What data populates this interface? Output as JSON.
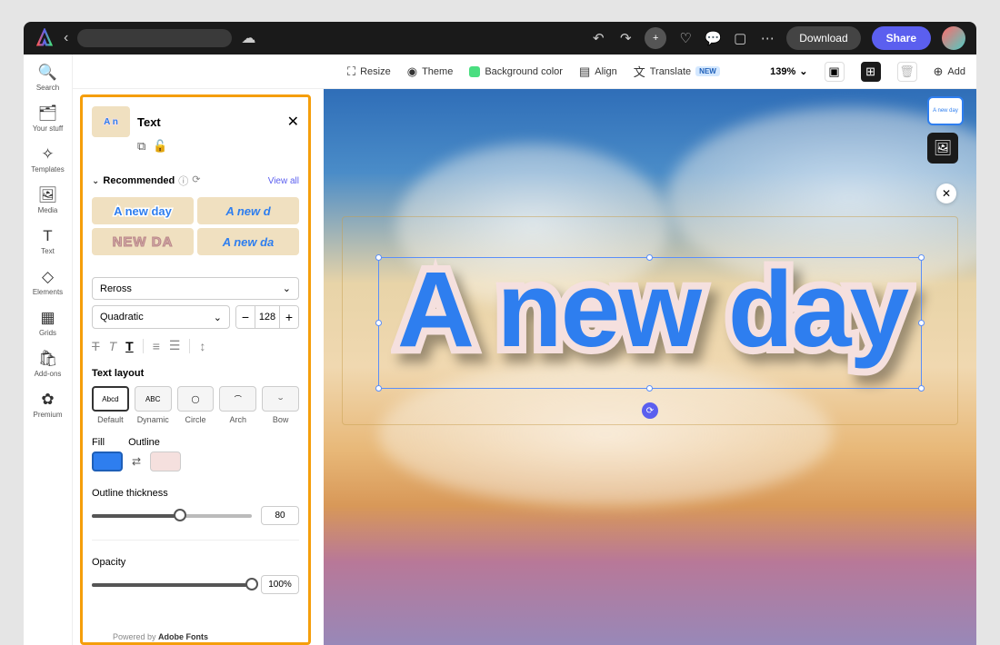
{
  "topbar": {
    "download": "Download",
    "share": "Share"
  },
  "rail": {
    "search": "Search",
    "your_stuff": "Your stuff",
    "templates": "Templates",
    "media": "Media",
    "text": "Text",
    "elements": "Elements",
    "grids": "Grids",
    "addons": "Add-ons",
    "premium": "Premium"
  },
  "toolbar": {
    "resize": "Resize",
    "theme": "Theme",
    "bgcolor": "Background color",
    "align": "Align",
    "translate": "Translate",
    "translate_badge": "NEW",
    "zoom": "139%",
    "add": "Add"
  },
  "panel": {
    "title": "Text",
    "thumb_text": "A n",
    "recommended": "Recommended",
    "view_all": "View all",
    "rec_items": [
      "A new day",
      "A new d",
      "NEW DA",
      "A new da"
    ],
    "font": "Reross",
    "style": "Quadratic",
    "size": "128",
    "text_layout_label": "Text layout",
    "layouts": [
      "Default",
      "Dynamic",
      "Circle",
      "Arch",
      "Bow"
    ],
    "layout_glyphs": [
      "Abcd",
      "ABC",
      "◯",
      "⌒",
      "⌣"
    ],
    "fill_label": "Fill",
    "outline_label": "Outline",
    "fill_color": "#2e7eef",
    "outline_color": "#f5e0de",
    "outline_thickness_label": "Outline thickness",
    "outline_thickness": "80",
    "opacity_label": "Opacity",
    "opacity": "100%"
  },
  "canvas": {
    "text": "A new day",
    "thumb_text": "A new day"
  },
  "footer": {
    "powered": "Powered by ",
    "adobe": "Adobe Fonts"
  }
}
